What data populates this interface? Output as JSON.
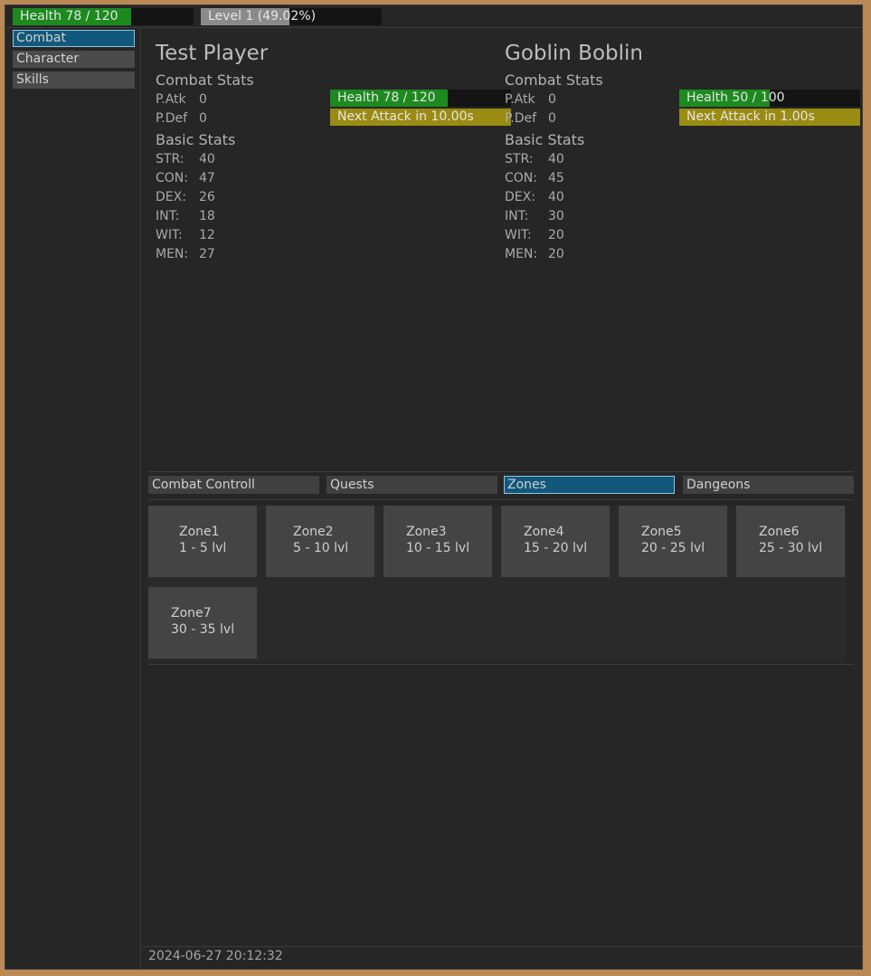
{
  "topbar": {
    "health": {
      "label": "Health 78 / 120",
      "current": 78,
      "max": 120
    },
    "level": {
      "label": "Level 1 (49.02%)",
      "progress": 0.4902
    }
  },
  "sidebar": {
    "items": [
      {
        "label": "Combat",
        "active": true
      },
      {
        "label": "Character",
        "active": false
      },
      {
        "label": "Skills",
        "active": false
      }
    ]
  },
  "player": {
    "name": "Test Player",
    "combat_stats_title": "Combat Stats",
    "patk_label": "P.Atk",
    "patk": "0",
    "pdef_label": "P.Def",
    "pdef": "0",
    "basic_stats_title": "Basic Stats",
    "stats": [
      {
        "k": "STR:",
        "v": "40"
      },
      {
        "k": "CON:",
        "v": "47"
      },
      {
        "k": "DEX:",
        "v": "26"
      },
      {
        "k": "INT:",
        "v": "18"
      },
      {
        "k": "WIT:",
        "v": "12"
      },
      {
        "k": "MEN:",
        "v": "27"
      }
    ],
    "health_label": "Health 78 / 120",
    "health_fraction": 0.65,
    "attack_label": "Next Attack in 10.00s",
    "attack_fraction": 1.0
  },
  "enemy": {
    "name": "Goblin Boblin",
    "combat_stats_title": "Combat Stats",
    "patk_label": "P.Atk",
    "patk": "0",
    "pdef_label": "P.Def",
    "pdef": "0",
    "basic_stats_title": "Basic Stats",
    "stats": [
      {
        "k": "STR:",
        "v": "40"
      },
      {
        "k": "CON:",
        "v": "45"
      },
      {
        "k": "DEX:",
        "v": "40"
      },
      {
        "k": "INT:",
        "v": "30"
      },
      {
        "k": "WIT:",
        "v": "20"
      },
      {
        "k": "MEN:",
        "v": "20"
      }
    ],
    "health_label": "Health 50 / 100",
    "health_fraction": 0.5,
    "attack_label": "Next Attack in 1.00s",
    "attack_fraction": 1.0
  },
  "tabs": [
    {
      "label": "Combat Controll",
      "active": false
    },
    {
      "label": "Quests",
      "active": false
    },
    {
      "label": "Zones",
      "active": true
    },
    {
      "label": "Dangeons",
      "active": false
    }
  ],
  "zones": [
    {
      "name": "Zone1",
      "levels": "1 - 5 lvl"
    },
    {
      "name": "Zone2",
      "levels": "5 - 10 lvl"
    },
    {
      "name": "Zone3",
      "levels": "10 - 15 lvl"
    },
    {
      "name": "Zone4",
      "levels": "15 - 20 lvl"
    },
    {
      "name": "Zone5",
      "levels": "20 - 25 lvl"
    },
    {
      "name": "Zone6",
      "levels": "25 - 30 lvl"
    },
    {
      "name": "Zone7",
      "levels": "30 - 35 lvl"
    }
  ],
  "footer": {
    "timestamp": "2024-06-27 20:12:32"
  },
  "colors": {
    "health": "#1d8a20",
    "level": "#8a8a8a",
    "attack": "#9a8b12",
    "active_tab": "#12587a"
  }
}
